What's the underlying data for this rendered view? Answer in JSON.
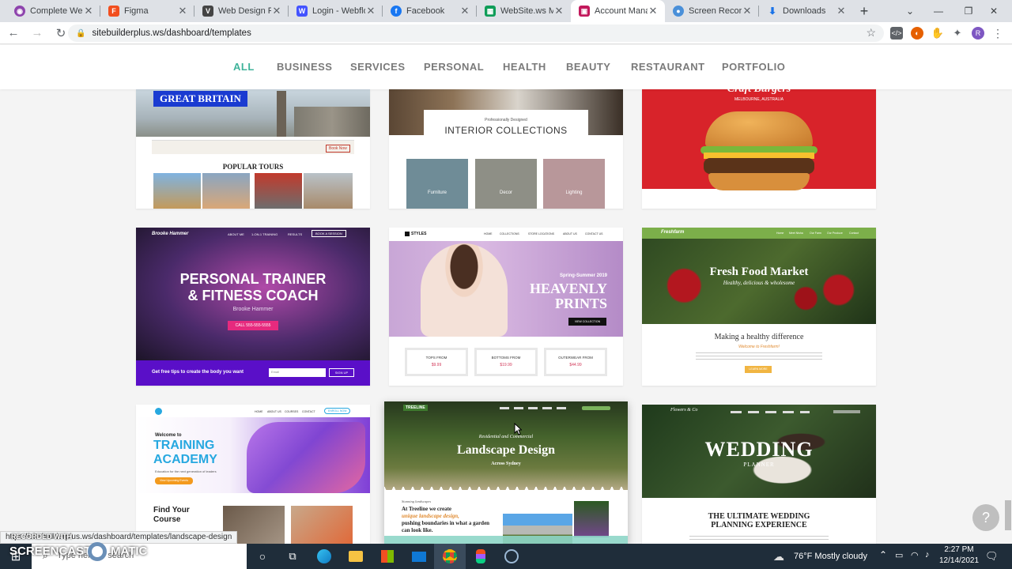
{
  "tabs": [
    {
      "label": "Complete Web",
      "icon": "circle-icon",
      "color": "#8e44ad"
    },
    {
      "label": "Figma",
      "icon": "figma-icon",
      "color": "#f24e1e"
    },
    {
      "label": "Web Design Re",
      "icon": "vimeo-icon",
      "color": "#1ab7ea"
    },
    {
      "label": "Login - Webflo",
      "icon": "webflow-icon",
      "color": "#4353ff"
    },
    {
      "label": "Facebook",
      "icon": "facebook-icon",
      "color": "#1877f2"
    },
    {
      "label": "WebSite.ws Me",
      "icon": "sheets-icon",
      "color": "#0f9d58"
    },
    {
      "label": "Account Manag",
      "icon": "account-icon",
      "color": "#c2185b"
    },
    {
      "label": "Screen Recorde",
      "icon": "recorder-icon",
      "color": "#4a90d9"
    },
    {
      "label": "Downloads",
      "icon": "download-icon",
      "color": "#1a73e8"
    }
  ],
  "address": {
    "url": "sitebuilderplus.ws/dashboard/templates"
  },
  "categories": [
    "ALL",
    "BUSINESS",
    "SERVICES",
    "PERSONAL",
    "HEALTH",
    "BEAUTY",
    "RESTAURANT",
    "PORTFOLIO"
  ],
  "templates": {
    "gb": {
      "title": "GREAT BRITAIN",
      "section": "POPULAR TOURS",
      "button": "Book Now"
    },
    "interior": {
      "kicker": "Professionally Designed",
      "title": "INTERIOR COLLECTIONS",
      "items": [
        "Furniture",
        "Decor",
        "Lighting"
      ]
    },
    "burger": {
      "title": "Craft Burgers",
      "subtitle": "MELBOURNE, AUSTRALIA"
    },
    "trainer": {
      "brand": "Brooke Hammer",
      "nav": [
        "ABOUT ME",
        "1-ON-1 TRAINING",
        "RESULTS",
        "BOOK A SESSION"
      ],
      "headline1": "PERSONAL TRAINER",
      "headline2": "& FITNESS COACH",
      "name": "Brooke Hammer",
      "cta": "CALL 555-555-5555",
      "footer": "Get free tips to create the body you want",
      "signup": "SIGN UP",
      "email_ph": "Email"
    },
    "styles": {
      "brand": "STYLES",
      "nav": [
        "HOME",
        "COLLECTIONS",
        "STORE LOCATIONS",
        "ABOUT US",
        "CONTACT US"
      ],
      "season": "Spring-Summer 2019",
      "headline1": "HEAVENLY",
      "headline2": "PRINTS",
      "cta": "VIEW COLLECTION",
      "cols": [
        {
          "label": "TOPS FROM",
          "price": "$9.99"
        },
        {
          "label": "BOTTOMS FROM",
          "price": "$19.99"
        },
        {
          "label": "OUTERWEAR FROM",
          "price": "$44.99"
        }
      ]
    },
    "food": {
      "brand": "Freshfarm",
      "nav": [
        "Home",
        "Meet Nisha",
        "Our Farm",
        "Our Produce",
        "Contact"
      ],
      "title": "Fresh Food Market",
      "subtitle": "Healthy, delicious & wholesome",
      "section": "Making a healthy difference",
      "welcome": "Welcome to Freshfarm!",
      "button": "LEARN MORE"
    },
    "academy": {
      "kicker": "Welcome to",
      "title1": "TRAINING",
      "title2": "ACADEMY",
      "tagline": "Education for the next generation of leaders",
      "button": "View Upcoming Events",
      "section": "Find Your",
      "section2": "Course",
      "nav": [
        "HOME",
        "ABOUT US",
        "COURSES",
        "CONTACT"
      ],
      "enroll": "ENROLL NOW"
    },
    "landscape": {
      "brand": "TREELINE",
      "kicker": "Residential and Commercial",
      "title": "Landscape Design",
      "subtitle": "Across Sydney",
      "section": "Stunning landscapes",
      "body1": "At Treeline we create",
      "body2": "unique landscape design,",
      "body3": "pushing boundaries in what a garden",
      "body4": "can look like."
    },
    "wedding": {
      "brand": "Flowers & Co",
      "title": "WEDDING",
      "subtitle": "PLANNER",
      "section1": "THE ULTIMATE WEDDING",
      "section2": "PLANNING EXPERIENCE"
    }
  },
  "status_url": "https://sitebuilderplus.ws/dashboard/templates/landscape-design",
  "watermark": {
    "line1": "RECORDED WITH",
    "line2": "SCREENCAST",
    "line3": "MATIC"
  },
  "taskbar": {
    "search_placeholder": "Type here to search",
    "weather": "76°F  Mostly cloudy",
    "time": "2:27 PM",
    "date": "12/14/2021"
  }
}
